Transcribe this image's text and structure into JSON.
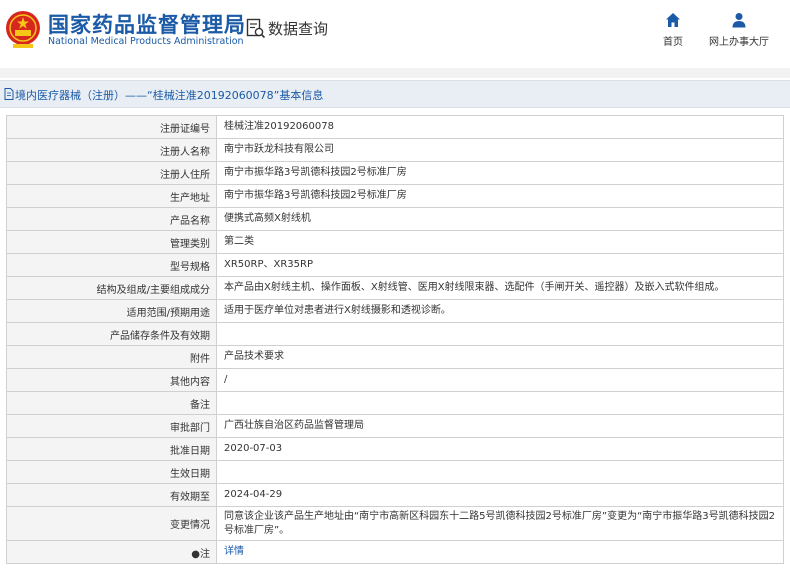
{
  "header": {
    "agency_cn": "国家药品监督管理局",
    "agency_en": "National Medical Products Administration",
    "section_title": "数据查询",
    "nav": [
      {
        "label": "首页",
        "icon": "home-icon"
      },
      {
        "label": "网上办事大厅",
        "icon": "person-icon"
      }
    ]
  },
  "breadcrumb": {
    "title": "境内医疗器械（注册）——“桂械注准20192060078”基本信息"
  },
  "colors": {
    "brand_blue": "#1a5aa6",
    "emblem_red": "#d7261e",
    "emblem_gold": "#f5c518",
    "label_bg": "#f4f4f4",
    "title_bar_bg": "#e9eef4"
  },
  "detail": {
    "rows": [
      {
        "label": "注册证编号",
        "value": "桂械注准20192060078"
      },
      {
        "label": "注册人名称",
        "value": "南宁市跃龙科技有限公司"
      },
      {
        "label": "注册人住所",
        "value": "南宁市振华路3号凯德科技园2号标准厂房"
      },
      {
        "label": "生产地址",
        "value": "南宁市振华路3号凯德科技园2号标准厂房"
      },
      {
        "label": "产品名称",
        "value": "便携式高频X射线机"
      },
      {
        "label": "管理类别",
        "value": "第二类"
      },
      {
        "label": "型号规格",
        "value": "XR50RP、XR35RP"
      },
      {
        "label": "结构及组成/主要组成成分",
        "value": "本产品由X射线主机、操作面板、X射线管、医用X射线限束器、选配件（手闸开关、遥控器）及嵌入式软件组成。"
      },
      {
        "label": "适用范围/预期用途",
        "value": "适用于医疗单位对患者进行X射线摄影和透视诊断。"
      },
      {
        "label": "产品储存条件及有效期",
        "value": ""
      },
      {
        "label": "附件",
        "value": "产品技术要求"
      },
      {
        "label": "其他内容",
        "value": "/"
      },
      {
        "label": "备注",
        "value": ""
      },
      {
        "label": "审批部门",
        "value": "广西壮族自治区药品监督管理局"
      },
      {
        "label": "批准日期",
        "value": "2020-07-03"
      },
      {
        "label": "生效日期",
        "value": ""
      },
      {
        "label": "有效期至",
        "value": "2024-04-29"
      },
      {
        "label": "变更情况",
        "value": "同意该企业该产品生产地址由“南宁市高新区科园东十二路5号凯德科技园2号标准厂房”变更为“南宁市振华路3号凯德科技园2号标准厂房”。"
      }
    ],
    "note_label": "●注",
    "note_link": "详情"
  }
}
